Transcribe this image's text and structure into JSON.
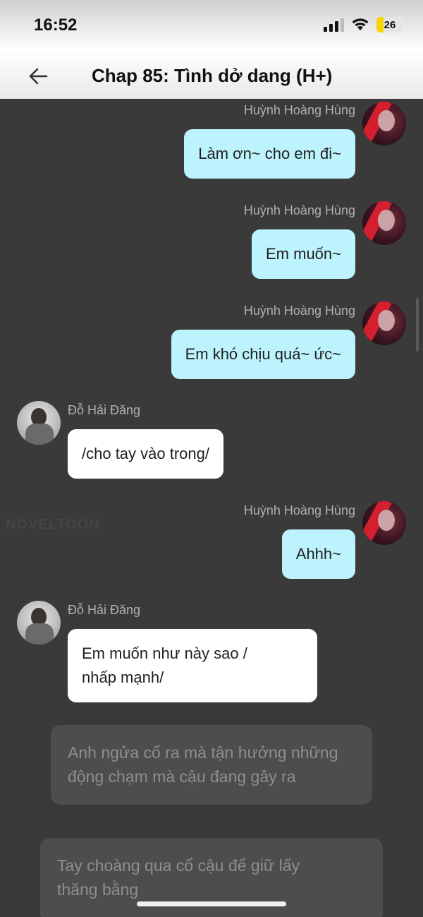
{
  "status": {
    "time": "16:52",
    "battery": "26"
  },
  "header": {
    "title": "Chap 85: Tình dở dang (H+)"
  },
  "watermark": "NOVELTOON",
  "messages": [
    {
      "name": "Huỳnh Hoàng Hùng",
      "text": "Làm ơn~ cho em đi~"
    },
    {
      "name": "Huỳnh Hoàng Hùng",
      "text": "Em muốn~"
    },
    {
      "name": "Huỳnh Hoàng Hùng",
      "text": "Em khó chịu quá~ ức~"
    },
    {
      "name": "Đỗ Hải Đăng",
      "text": "/cho tay vào trong/"
    },
    {
      "name": "Huỳnh Hoàng Hùng",
      "text": "Ahhh~"
    },
    {
      "name": "Đỗ Hải Đăng",
      "line1": "Em muốn như này sao /",
      "line2": "nhấp mạnh/"
    }
  ],
  "narration": [
    {
      "line1": "Anh ngửa cổ ra mà tận hưởng những",
      "line2": "động chạm mà cậu đang gây ra"
    },
    {
      "line1": "Tay choàng qua cổ cậu để giữ lấy",
      "line2": "thăng bằng"
    }
  ],
  "colors": {
    "right_bubble": "#bdf3fc",
    "left_bubble": "#ffffff",
    "background": "#3a3a3a"
  }
}
